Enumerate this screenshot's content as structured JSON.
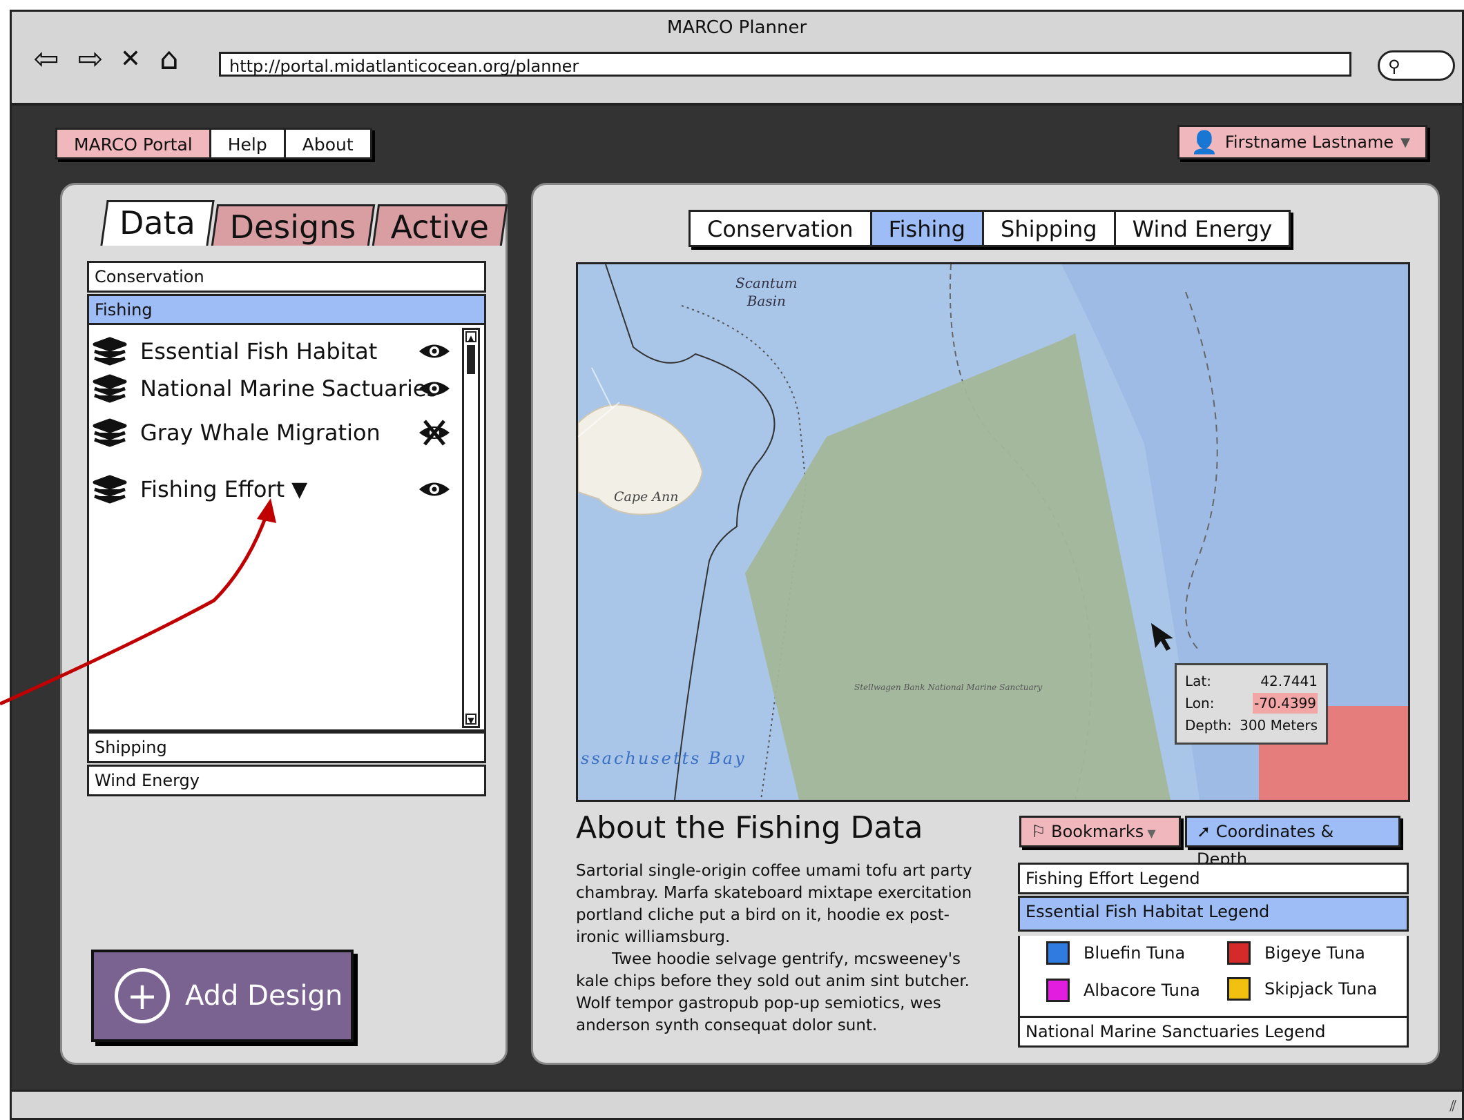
{
  "window": {
    "title": "MARCO Planner",
    "url": "http://portal.midatlanticocean.org/planner"
  },
  "topnav": {
    "portal": "MARCO Portal",
    "help": "Help",
    "about": "About"
  },
  "user": {
    "name": "Firstname Lastname"
  },
  "left": {
    "tabs": [
      "Data",
      "Designs",
      "Active"
    ],
    "active_tab": "Data",
    "sections": {
      "conservation": "Conservation",
      "fishing": "Fishing",
      "shipping": "Shipping",
      "wind": "Wind Energy"
    },
    "layers": [
      {
        "label": "Essential Fish Habitat",
        "visible": true
      },
      {
        "label": "National Marine Sactuaries",
        "visible": true
      },
      {
        "label": "Gray Whale Migration",
        "visible": false
      },
      {
        "label": "Fishing Effort",
        "visible": true,
        "has_dropdown": true
      }
    ],
    "add_design": "Add Design"
  },
  "themes": {
    "items": [
      "Conservation",
      "Fishing",
      "Shipping",
      "Wind Energy"
    ],
    "selected": "Fishing"
  },
  "map": {
    "labels": {
      "basin": "Scantum",
      "basin2": "Basin",
      "cape": "Cape Ann",
      "bay": "ssachusetts Bay",
      "sanctuary": "Stellwagen Bank National Marine Sanctuary"
    },
    "readout": {
      "lat_label": "Lat:",
      "lat": "42.7441",
      "lon_label": "Lon:",
      "lon": "-70.4399",
      "depth_label": "Depth:",
      "depth": "300 Meters"
    }
  },
  "about": {
    "title": "About the Fishing Data",
    "p1": "Sartorial single-origin coffee umami tofu art party chambray. Marfa skateboard mixtape exercitation portland cliche put a bird on it, hoodie ex post-ironic williamsburg.",
    "p2": "Twee hoodie selvage gentrify, mcsweeney's kale chips before they sold out anim sint butcher. Wolf tempor gastropub pop-up semiotics, wes anderson synth consequat dolor sunt."
  },
  "tools": {
    "bookmarks": "Bookmarks",
    "coords": "Coordinates & Depth"
  },
  "legends": {
    "fishing_effort": "Fishing Effort Legend",
    "efh": "Essential Fish Habitat Legend",
    "nms": "National Marine Sanctuaries Legend",
    "items": [
      {
        "label": "Bluefin Tuna",
        "color": "#2f7be0"
      },
      {
        "label": "Bigeye Tuna",
        "color": "#d42a2a"
      },
      {
        "label": "Albacore Tuna",
        "color": "#e11de0"
      },
      {
        "label": "Skipjack Tuna",
        "color": "#f2c00f"
      }
    ]
  },
  "colors": {
    "selected": "#9ebcf5",
    "pink": "#f0b8bc",
    "purple": "#7a6390",
    "annotation": "#c00000"
  }
}
